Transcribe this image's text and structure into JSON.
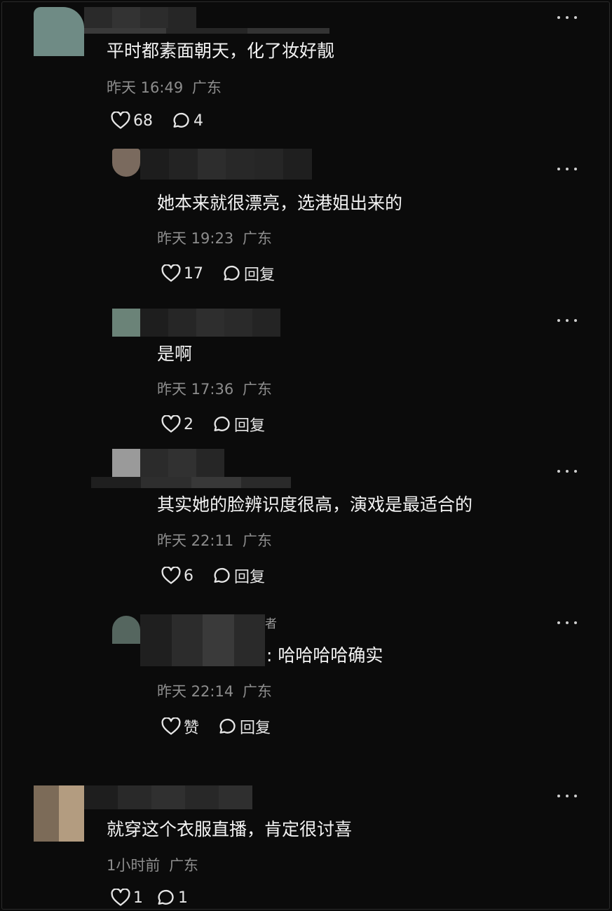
{
  "comments": [
    {
      "text": "平时都素面朝天，化了妆好靓",
      "time": "昨天 16:49",
      "location": "广东",
      "likes": "68",
      "replies": "4"
    },
    {
      "text": "她本来就很漂亮，选港姐出来的",
      "time": "昨天 19:23",
      "location": "广东",
      "likes": "17",
      "replies": "回复"
    },
    {
      "text": "是啊",
      "time": "昨天 17:36",
      "location": "广东",
      "likes": "2",
      "replies": "回复"
    },
    {
      "text": "其实她的脸辨识度很高，演戏是最适合的",
      "time": "昨天 22:11",
      "location": "广东",
      "likes": "6",
      "replies": "回复"
    },
    {
      "tag": "者",
      "text": ": 哈哈哈哈确实",
      "time": "昨天 22:14",
      "location": "广东",
      "likes": "赞",
      "replies": "回复"
    },
    {
      "text": "就穿这个衣服直播，肯定很讨喜",
      "time": "1小时前",
      "location": "广东",
      "likes": "1",
      "replies": "1"
    }
  ],
  "icons": {
    "like": "heart-outline-icon",
    "reply": "speech-bubble-icon",
    "more": "more-dots-icon"
  },
  "colors": {
    "background": "#0b0b0b",
    "text": "#f3f3f3",
    "meta": "#8d8d8d"
  }
}
